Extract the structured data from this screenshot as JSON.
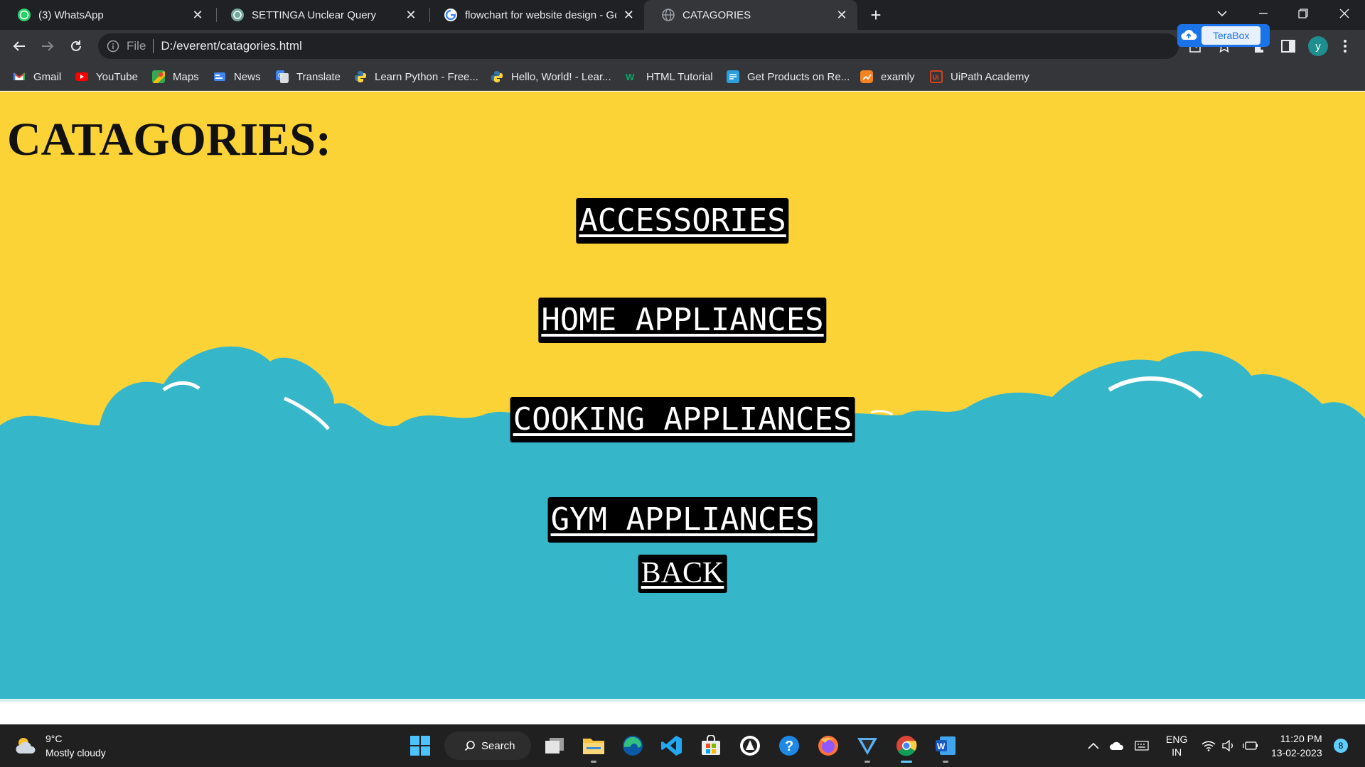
{
  "browser": {
    "tabs": [
      {
        "title": "(3) WhatsApp",
        "icon": "whatsapp-icon"
      },
      {
        "title": "SETTINGA Unclear Query",
        "icon": "chatgpt-icon"
      },
      {
        "title": "flowchart for website design - Go",
        "icon": "google-icon"
      },
      {
        "title": "CATAGORIES",
        "icon": "globe-icon",
        "active": true
      }
    ],
    "new_tab_label": "+",
    "address": {
      "scheme": "File",
      "url": "D:/everent/catagories.html"
    },
    "terabox_label": "TeraBox",
    "profile_initial": "y",
    "bookmarks": [
      {
        "label": "Gmail",
        "icon": "gmail-icon"
      },
      {
        "label": "YouTube",
        "icon": "youtube-icon"
      },
      {
        "label": "Maps",
        "icon": "maps-icon"
      },
      {
        "label": "News",
        "icon": "news-icon"
      },
      {
        "label": "Translate",
        "icon": "translate-icon"
      },
      {
        "label": "Learn Python - Free...",
        "icon": "python-icon"
      },
      {
        "label": "Hello, World! - Lear...",
        "icon": "python-icon"
      },
      {
        "label": "HTML Tutorial",
        "icon": "w3schools-icon"
      },
      {
        "label": "Get Products on Re...",
        "icon": "products-icon"
      },
      {
        "label": "examly",
        "icon": "examly-icon"
      },
      {
        "label": "UiPath Academy",
        "icon": "uipath-icon"
      }
    ]
  },
  "page": {
    "title": "CATAGORIES:",
    "categories": [
      "ACCESSORIES",
      "HOME APPLIANCES",
      "COOKING APPLIANCES",
      "GYM APPLIANCES"
    ],
    "back_label": "BACK",
    "colors": {
      "sky": "#fcd337",
      "cloud": "#36b6c9",
      "button_bg": "#000000",
      "button_text": "#ffffff"
    }
  },
  "taskbar": {
    "weather": {
      "temp": "9°C",
      "desc": "Mostly cloudy"
    },
    "search_label": "Search",
    "language": {
      "line1": "ENG",
      "line2": "IN"
    },
    "time": "11:20 PM",
    "date": "13-02-2023",
    "notification_count": "8"
  }
}
